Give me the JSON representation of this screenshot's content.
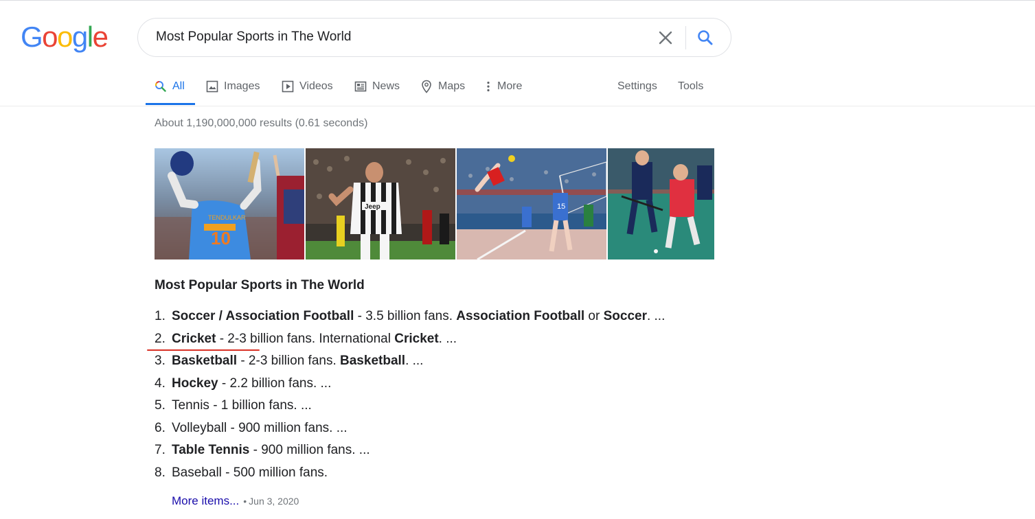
{
  "logo": {
    "text": "Google",
    "letters": [
      "G",
      "o",
      "o",
      "g",
      "l",
      "e"
    ],
    "colors": [
      "#4285F4",
      "#EA4335",
      "#FBBC05",
      "#4285F4",
      "#34A853",
      "#EA4335"
    ]
  },
  "search": {
    "query": "Most Popular Sports in The World",
    "clear_icon": "close-icon",
    "search_icon": "search-icon"
  },
  "tabs": [
    {
      "label": "All",
      "icon": "search-icon",
      "active": true
    },
    {
      "label": "Images",
      "icon": "image-icon"
    },
    {
      "label": "Videos",
      "icon": "play-icon"
    },
    {
      "label": "News",
      "icon": "news-icon"
    },
    {
      "label": "Maps",
      "icon": "map-pin-icon"
    },
    {
      "label": "More",
      "icon": "dots-vertical-icon"
    }
  ],
  "tools": {
    "settings": "Settings",
    "tools": "Tools"
  },
  "stats": "About 1,190,000,000 results (0.61 seconds)",
  "images": [
    {
      "alt": "cricket"
    },
    {
      "alt": "soccer"
    },
    {
      "alt": "volleyball"
    },
    {
      "alt": "hockey"
    }
  ],
  "snippet": {
    "title": "Most Popular Sports in The World",
    "items": [
      {
        "num": "1.",
        "bold": "Soccer / Association Football",
        "rest": " - 3.5 billion fans. ",
        "bold2": "Association Football",
        "rest2": " or ",
        "bold3": "Soccer",
        "rest3": ". ..."
      },
      {
        "num": "2.",
        "bold": "Cricket",
        "rest": " - 2-3 billion fans. International ",
        "bold2": "Cricket",
        "rest2": ". ..."
      },
      {
        "num": "3.",
        "bold": "Basketball",
        "rest": " - 2-3 billion fans. ",
        "bold2": "Basketball",
        "rest2": ". ..."
      },
      {
        "num": "4.",
        "bold": "Hockey",
        "rest": " - 2.2 billion fans. ..."
      },
      {
        "num": "5.",
        "rest": "Tennis - 1 billion fans. ..."
      },
      {
        "num": "6.",
        "rest": "Volleyball - 900 million fans. ..."
      },
      {
        "num": "7.",
        "bold": "Table Tennis",
        "rest": " - 900 million fans. ..."
      },
      {
        "num": "8.",
        "rest": "Baseball - 500 million fans."
      }
    ],
    "more_link": "More items...",
    "date": "Jun 3, 2020"
  },
  "colors": {
    "accent": "#1a73e8",
    "link": "#1a0dab",
    "annotation": "#d93025"
  }
}
